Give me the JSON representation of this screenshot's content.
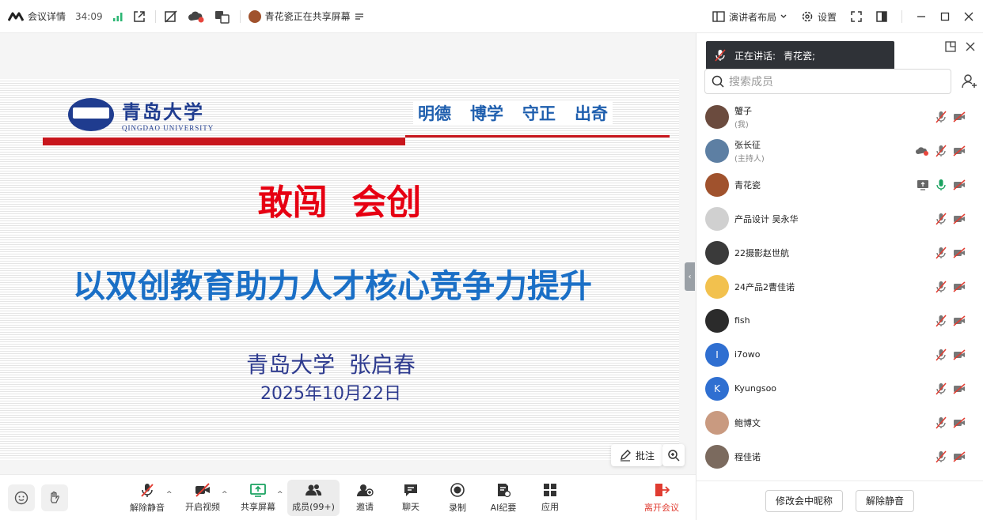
{
  "topbar": {
    "meeting_details": "会议详情",
    "duration": "34:09",
    "sharing_status": "青花瓷正在共享屏幕",
    "presenter_layout": "演讲者布局",
    "settings": "设置"
  },
  "slide": {
    "university_name_cn": "青岛大学",
    "university_name_en": "QINGDAO UNIVERSITY",
    "motto": [
      "明德",
      "博学",
      "守正",
      "出奇"
    ],
    "title": "敢闯  会创",
    "subtitle": "以双创教育助力人才核心竞争力提升",
    "author": "青岛大学  张启春",
    "date": "2025年10月22日"
  },
  "stage_tools": {
    "annotate": "批注"
  },
  "toolbar": {
    "unmute": "解除静音",
    "start_video": "开启视频",
    "share_screen": "共享屏幕",
    "members": "成员(99+)",
    "invite": "邀请",
    "chat": "聊天",
    "record": "录制",
    "ai_notes": "AI纪要",
    "apps": "应用",
    "leave": "离开会议"
  },
  "panel": {
    "speaking_label": "正在讲话:",
    "speaking_name": "青花瓷;",
    "search_placeholder": "搜索成员",
    "rename_button": "修改会中昵称",
    "unmute_button": "解除静音"
  },
  "members": [
    {
      "name": "蟹子",
      "role": "(我)",
      "avatar_color": "#6b4b3e",
      "mic": "muted",
      "extra": ""
    },
    {
      "name": "张长征",
      "role": "(主持人)",
      "avatar_color": "#5d7fa3",
      "mic": "muted",
      "extra": "cloud"
    },
    {
      "name": "青花瓷",
      "role": "",
      "avatar_color": "#a0522d",
      "mic": "on",
      "extra": "screen"
    },
    {
      "name": "产品设计 吴永华",
      "role": "",
      "avatar_color": "#d0d0d0",
      "mic": "muted",
      "extra": ""
    },
    {
      "name": "22摄影赵世航",
      "role": "",
      "avatar_color": "#3a3a3a",
      "mic": "muted",
      "extra": ""
    },
    {
      "name": "24产品2曹佳诺",
      "role": "",
      "avatar_color": "#f2c14e",
      "mic": "muted",
      "extra": ""
    },
    {
      "name": "fish",
      "role": "",
      "avatar_color": "#2b2b2b",
      "mic": "muted",
      "extra": ""
    },
    {
      "name": "i7owo",
      "role": "",
      "avatar_color": "#2f6fd1",
      "initial": "I",
      "mic": "muted",
      "extra": ""
    },
    {
      "name": "Kyungsoo",
      "role": "",
      "avatar_color": "#2f6fd1",
      "initial": "K",
      "mic": "muted",
      "extra": ""
    },
    {
      "name": "鲍博文",
      "role": "",
      "avatar_color": "#c99a80",
      "mic": "muted",
      "extra": ""
    },
    {
      "name": "程佳诺",
      "role": "",
      "avatar_color": "#7b6a5e",
      "mic": "muted",
      "extra": ""
    }
  ]
}
